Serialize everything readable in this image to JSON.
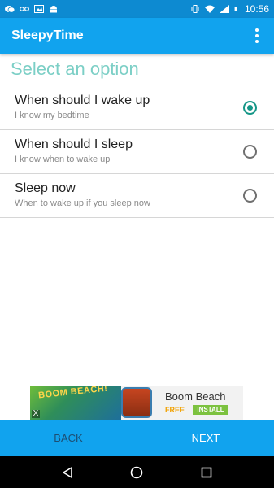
{
  "status_bar": {
    "time": "10:56",
    "left_icons": [
      "chat-icon",
      "voicemail-icon",
      "image-icon",
      "android-icon"
    ],
    "right_icons": [
      "vibrate-icon",
      "wifi-icon",
      "signal-icon",
      "battery-icon"
    ]
  },
  "app_bar": {
    "title": "SleepyTime",
    "menu_icon": "more-vert-icon"
  },
  "content": {
    "section_title": "Select an option",
    "options": [
      {
        "title": "When should I wake up",
        "subtitle": "I know my bedtime",
        "selected": true
      },
      {
        "title": "When should I sleep",
        "subtitle": "I know when to wake up",
        "selected": false
      },
      {
        "title": "Sleep now",
        "subtitle": "When to wake up if you sleep now",
        "selected": false
      }
    ]
  },
  "ad": {
    "art_text": "BOOM BEACH!",
    "title": "Boom Beach",
    "price": "FREE",
    "install_label": "INSTALL",
    "close": "X"
  },
  "bottom_bar": {
    "back_label": "BACK",
    "next_label": "NEXT"
  },
  "nav_bar": {
    "back_icon": "triangle-back-icon",
    "home_icon": "circle-home-icon",
    "recents_icon": "square-recents-icon"
  },
  "colors": {
    "primary": "#11a3ee",
    "status": "#0d8ad1",
    "accent": "#159687",
    "section_title": "#7ccfc6"
  }
}
